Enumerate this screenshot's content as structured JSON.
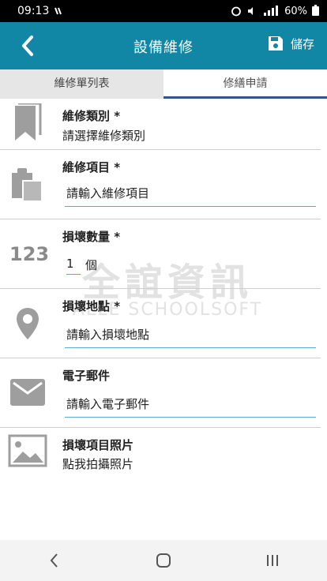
{
  "status_bar": {
    "time": "09:13",
    "battery": "60%"
  },
  "header": {
    "title": "設備維修",
    "save_label": "儲存"
  },
  "tabs": [
    {
      "label": "維修單列表",
      "active": false
    },
    {
      "label": "修繕申請",
      "active": true
    }
  ],
  "form": {
    "category": {
      "label": "維修類別 *",
      "value": "請選擇維修類別"
    },
    "item": {
      "label": "維修項目 *",
      "placeholder": "請輸入維修項目"
    },
    "quantity": {
      "label": "損壞數量 *",
      "value": "1",
      "unit": "個"
    },
    "location": {
      "label": "損壞地點 *",
      "placeholder": "請輸入損壞地點"
    },
    "email": {
      "label": "電子郵件",
      "placeholder": "請輸入電子郵件"
    },
    "photo": {
      "label": "損壞項目照片",
      "action": "點我拍攝照片"
    }
  },
  "watermark": {
    "chinese": "全誼資訊",
    "english": "ALLE SCHOOLSOFT"
  },
  "colors": {
    "app_bar": "#1187a5",
    "tab_indicator": "#3c4f8e",
    "input_underline": "#5aa9d6",
    "icon_gray": "#9e9e9e"
  }
}
